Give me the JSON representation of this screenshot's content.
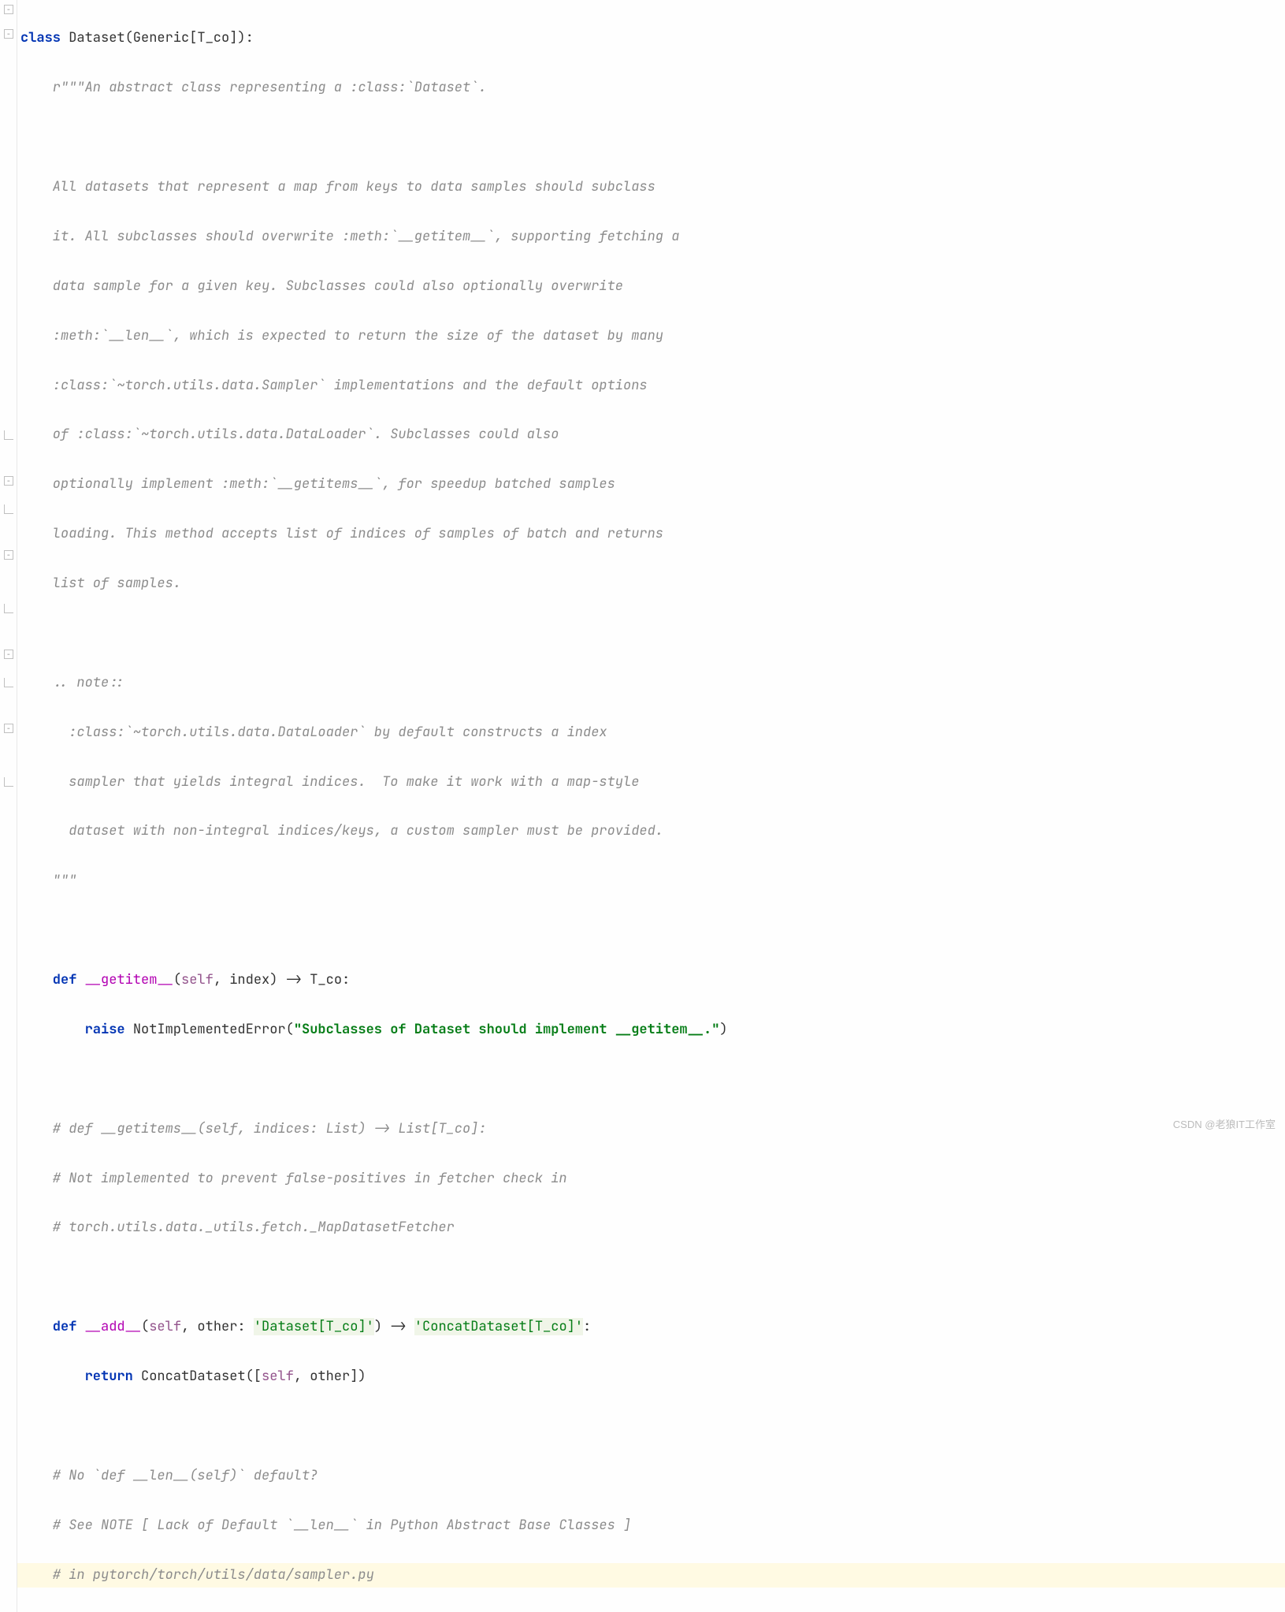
{
  "code": {
    "line1_kw": "class",
    "line1_name": " Dataset",
    "line1_rest": "(Generic[T_co]):",
    "doc_open": "    r\"\"\"An abstract class representing a :class:`Dataset`.",
    "doc_blank1": "",
    "doc_l1": "    All datasets that represent a map from keys to data samples should subclass",
    "doc_l2": "    it. All subclasses should overwrite :meth:`__getitem__`, supporting fetching a",
    "doc_l3": "    data sample for a given key. Subclasses could also optionally overwrite",
    "doc_l4": "    :meth:`__len__`, which is expected to return the size of the dataset by many",
    "doc_l5": "    :class:`~torch.utils.data.Sampler` implementations and the default options",
    "doc_l6": "    of :class:`~torch.utils.data.DataLoader`. Subclasses could also",
    "doc_l7": "    optionally implement :meth:`__getitems__`, for speedup batched samples",
    "doc_l8": "    loading. This method accepts list of indices of samples of batch and returns",
    "doc_l9": "    list of samples.",
    "doc_blank2": "",
    "doc_note": "    .. note::",
    "doc_n1": "      :class:`~torch.utils.data.DataLoader` by default constructs a index",
    "doc_n2": "      sampler that yields integral indices.  To make it work with a map-style",
    "doc_n3": "      dataset with non-integral indices/keys, a custom sampler must be provided.",
    "doc_close": "    \"\"\"",
    "blank3": "",
    "gi_kw": "    def ",
    "gi_name": "__getitem__",
    "gi_paren_open": "(",
    "gi_self": "self",
    "gi_rest": ", index) -> T_co:",
    "gi_body_kw": "        raise ",
    "gi_body_exc": "NotImplementedError(",
    "gi_body_str": "\"Subclasses of Dataset should implement __getitem__.\"",
    "gi_body_close": ")",
    "blank4": "",
    "c1": "    # def __getitems__(self, indices: List) -> List[T_co]:",
    "c2": "    # Not implemented to prevent false-positives in fetcher check in",
    "c3": "    # torch.utils.data._utils.fetch._MapDatasetFetcher",
    "blank5": "",
    "add_kw": "    def ",
    "add_name": "__add__",
    "add_paren_open": "(",
    "add_self": "self",
    "add_mid1": ", other: ",
    "add_str1": "'Dataset[T_co]'",
    "add_mid2": ") -> ",
    "add_str2": "'ConcatDataset[T_co]'",
    "add_end": ":",
    "add_body_kw": "        return ",
    "add_body_call": "ConcatDataset([",
    "add_body_self": "self",
    "add_body_rest": ", other])",
    "blank6": "",
    "c4": "    # No `def __len__(self)` default?",
    "c5": "    # See NOTE [ Lack of Default `__len__` in Python Abstract Base Classes ]",
    "c6": "    # in pytorch/torch/utils/data/sampler.py"
  },
  "watermark": "CSDN @老狼IT工作室"
}
